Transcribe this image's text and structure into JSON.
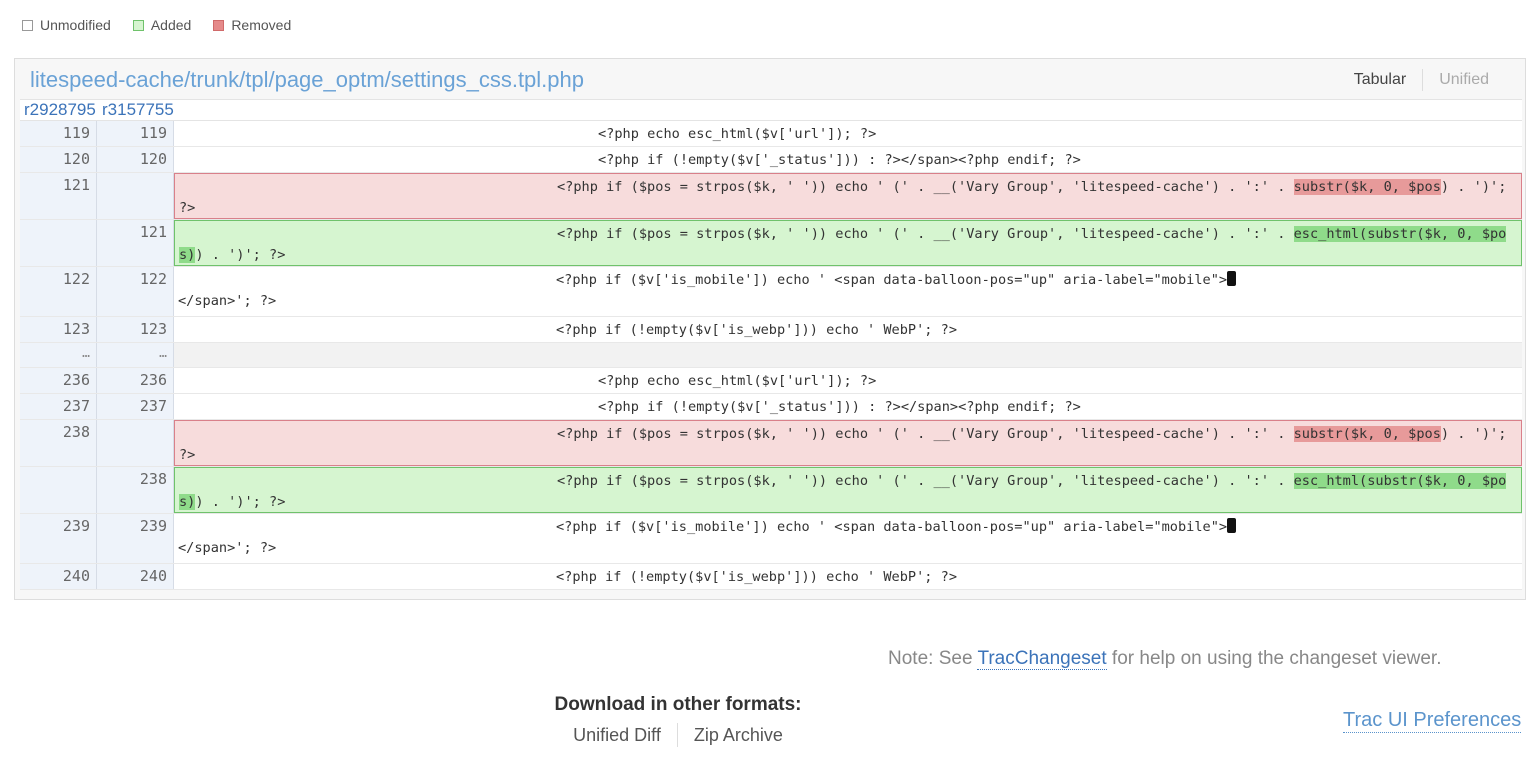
{
  "legend": {
    "unmodified": "Unmodified",
    "added": "Added",
    "removed": "Removed",
    "colors": {
      "unmodified": "#ffffff",
      "added": "#d6f5d0",
      "removed": "#e58a8a"
    }
  },
  "file": {
    "path": "litespeed-cache/trunk/tpl/page_optm/settings_css.tpl.php",
    "view_tabular": "Tabular",
    "view_unified": "Unified",
    "rev_old": "r2928795",
    "rev_new": "r3157755"
  },
  "rows": [
    {
      "type": "ctx",
      "old": "119",
      "new": "119",
      "pre": "",
      "hl": "",
      "post": "<?php echo esc_html($v['url']); ?>",
      "indent": "deep"
    },
    {
      "type": "ctx",
      "old": "120",
      "new": "120",
      "pre": "",
      "hl": "",
      "post": "<?php if (!empty($v['_status'])) : ?></span><?php endif; ?>",
      "indent": "deep"
    },
    {
      "type": "rem",
      "old": "121",
      "new": "",
      "pre": "<?php if ($pos = strpos($k, ' ')) echo ' (' . __('Vary Group', 'litespeed-cache') . ':' . ",
      "hl": "substr($k, 0, $pos",
      "post": ") . ')'; ?>",
      "indent": "mid"
    },
    {
      "type": "add",
      "old": "",
      "new": "121",
      "pre": "<?php if ($pos = strpos($k, ' ')) echo ' (' . __('Vary Group', 'litespeed-cache') . ':' . ",
      "hl": "esc_html(substr($k, 0, $pos)",
      "post": ") . ')'; ?>",
      "indent": "mid"
    },
    {
      "type": "ctx",
      "old": "122",
      "new": "122",
      "pre": "",
      "hl": "",
      "post": "<?php if ($v['is_mobile']) echo ' <span data-balloon-pos=\"up\" aria-label=\"mobile\">",
      "tail": "</span>'; ?>",
      "phone": true,
      "indent": "mid"
    },
    {
      "type": "ctx",
      "old": "123",
      "new": "123",
      "pre": "",
      "hl": "",
      "post": "<?php if (!empty($v['is_webp'])) echo ' WebP'; ?>",
      "indent": "mid"
    },
    {
      "type": "skip",
      "old": "…",
      "new": "…"
    },
    {
      "type": "ctx",
      "old": "236",
      "new": "236",
      "pre": "",
      "hl": "",
      "post": "<?php echo esc_html($v['url']); ?>",
      "indent": "deep"
    },
    {
      "type": "ctx",
      "old": "237",
      "new": "237",
      "pre": "",
      "hl": "",
      "post": "<?php if (!empty($v['_status'])) : ?></span><?php endif; ?>",
      "indent": "deep"
    },
    {
      "type": "rem",
      "old": "238",
      "new": "",
      "pre": "<?php if ($pos = strpos($k, ' ')) echo ' (' . __('Vary Group', 'litespeed-cache') . ':' . ",
      "hl": "substr($k, 0, $pos",
      "post": ") . ')'; ?>",
      "indent": "mid"
    },
    {
      "type": "add",
      "old": "",
      "new": "238",
      "pre": "<?php if ($pos = strpos($k, ' ')) echo ' (' . __('Vary Group', 'litespeed-cache') . ':' . ",
      "hl": "esc_html(substr($k, 0, $pos)",
      "post": ") . ')'; ?>",
      "indent": "mid"
    },
    {
      "type": "ctx",
      "old": "239",
      "new": "239",
      "pre": "",
      "hl": "",
      "post": "<?php if ($v['is_mobile']) echo ' <span data-balloon-pos=\"up\" aria-label=\"mobile\">",
      "tail": "</span>'; ?>",
      "phone": true,
      "indent": "mid"
    },
    {
      "type": "ctx",
      "old": "240",
      "new": "240",
      "pre": "",
      "hl": "",
      "post": "<?php if (!empty($v['is_webp'])) echo ' WebP'; ?>",
      "indent": "mid"
    }
  ],
  "note": {
    "label": "Note:",
    "text_before": " See ",
    "link": "TracChangeset",
    "text_after": " for help on using the changeset viewer."
  },
  "download": {
    "title": "Download in other formats:",
    "unified_diff": "Unified Diff",
    "zip_archive": "Zip Archive"
  },
  "prefs": "Trac UI Preferences"
}
